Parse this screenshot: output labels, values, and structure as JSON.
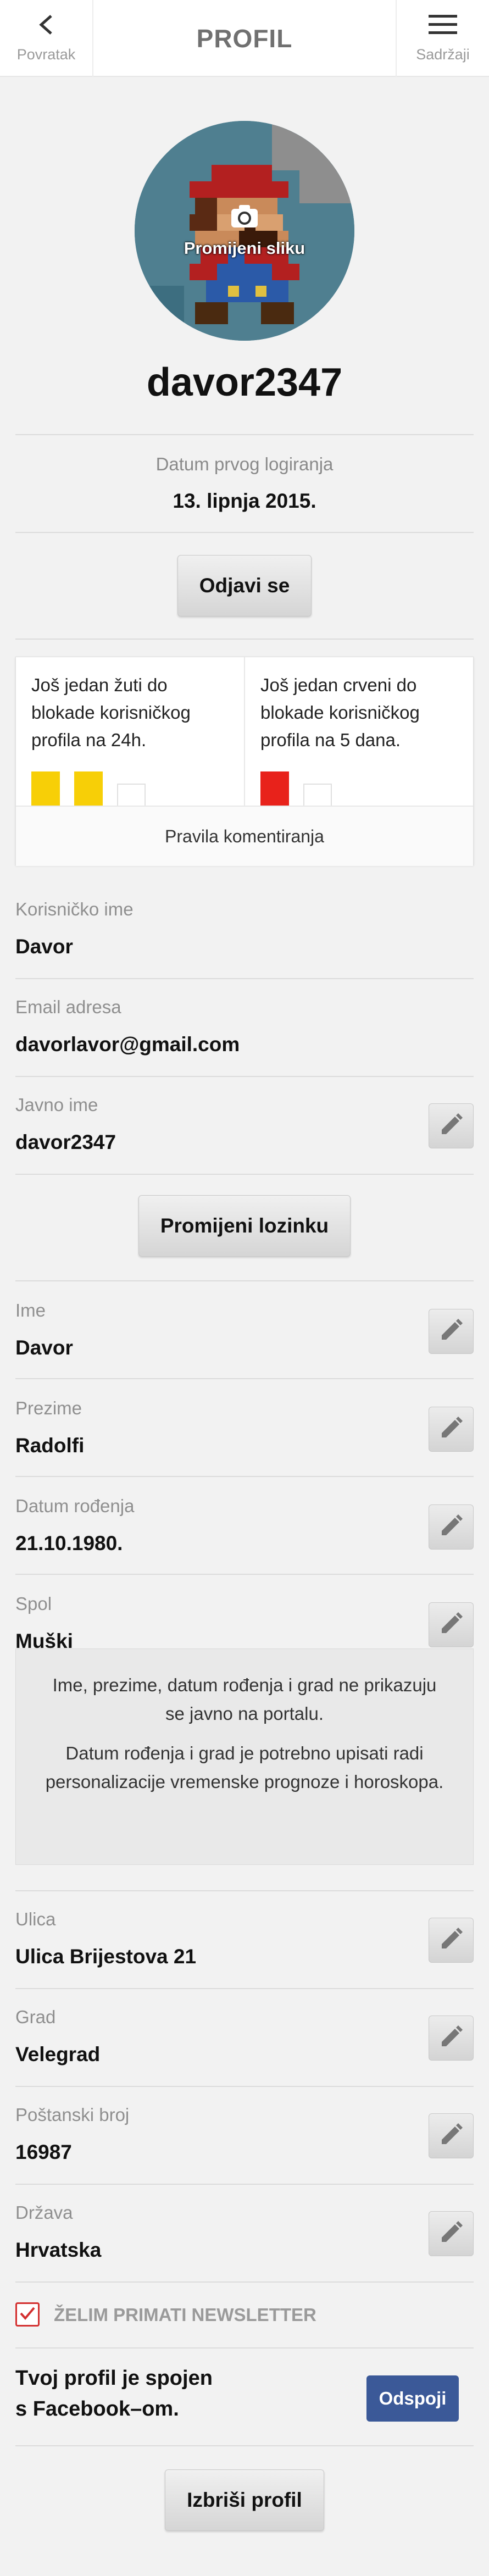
{
  "header": {
    "back_label": "Povratak",
    "title": "PROFIL",
    "menu_label": "Sadržaji"
  },
  "avatar": {
    "change_label": "Promijeni sliku"
  },
  "username": "davor2347",
  "first_login": {
    "label": "Datum prvog logiranja",
    "value": "13. lipnja 2015."
  },
  "logout_label": "Odjavi se",
  "blockade": {
    "yellow_text": "Još jedan žuti do blokade korisničkog profila na 24h.",
    "red_text": "Još jedan crveni do blokade korisničkog profila na 5 dana.",
    "yellow_cards_received": 2,
    "yellow_cards_total": 3,
    "red_cards_received": 1,
    "red_cards_total": 2,
    "rules_label": "Pravila komentiranja",
    "colors": {
      "yellow": "#f7cf07",
      "red": "#e8221b"
    }
  },
  "account": {
    "username_label": "Korisničko ime",
    "username_value": "Davor",
    "email_label": "Email adresa",
    "email_value": "davorlavor@gmail.com",
    "public_label": "Javno ime",
    "public_value": "davor2347"
  },
  "change_password_label": "Promijeni lozinku",
  "personal": {
    "first_name_label": "Ime",
    "first_name_value": "Davor",
    "last_name_label": "Prezime",
    "last_name_value": "Radolfi",
    "birth_label": "Datum rođenja",
    "birth_value": "21.10.1980.",
    "gender_label": "Spol",
    "gender_value": "Muški"
  },
  "info": {
    "line1": "Ime, prezime, datum rođenja i grad ne prikazuju se javno na portalu.",
    "line2": "Datum rođenja i grad je potrebno upisati radi personalizacije vremenske prognoze i horoskopa."
  },
  "address": {
    "street_label": "Ulica",
    "street_value": "Ulica Brijestova 21",
    "city_label": "Grad",
    "city_value": "Velegrad",
    "postal_label": "Poštanski broj",
    "postal_value": "16987",
    "country_label": "Država",
    "country_value": "Hrvatska"
  },
  "newsletter": {
    "label": "ŽELIM PRIMATI NEWSLETTER",
    "checked": true
  },
  "facebook": {
    "text_line1": "Tvoj profil je spojen",
    "text_line2": "s Facebook–om.",
    "disconnect_label": "Odspoji",
    "color": "#3b5998"
  },
  "delete_label": "Izbriši profil",
  "icons": {
    "back": "chevron-left-icon",
    "menu": "hamburger-menu-icon",
    "camera": "camera-icon",
    "edit": "pencil-icon",
    "check": "checkmark-icon"
  }
}
